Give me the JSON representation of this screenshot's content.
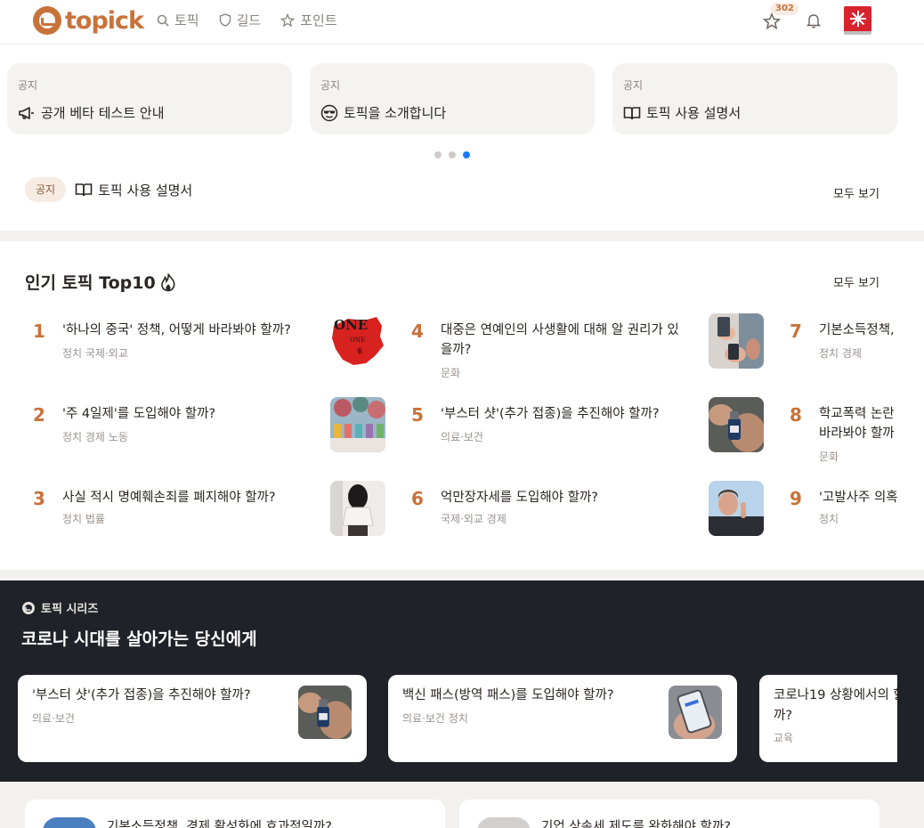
{
  "header": {
    "logo_text": "topick",
    "nav": [
      {
        "label": "토픽",
        "icon": "search-icon"
      },
      {
        "label": "길드",
        "icon": "shield-icon"
      },
      {
        "label": "포인트",
        "icon": "star-icon"
      }
    ],
    "points_badge": "302"
  },
  "notices": [
    {
      "label": "공지",
      "title": "공개 베타 테스트 안내",
      "icon": "megaphone-icon"
    },
    {
      "label": "공지",
      "title": "토픽을 소개합니다",
      "icon": "sunglasses-face-icon"
    },
    {
      "label": "공지",
      "title": "토픽 사용 설명서",
      "icon": "book-icon"
    }
  ],
  "carousel": {
    "count": 3,
    "active_index": 2
  },
  "notice_row": {
    "pill": "공지",
    "title": "토픽 사용 설명서",
    "see_all": "모두 보기"
  },
  "top10": {
    "title": "인기 토픽 Top10",
    "see_all": "모두 보기",
    "items": [
      {
        "rank": "1",
        "title": "'하나의 중국' 정책, 어떻게 바라봐야 할까?",
        "tags": "정치 국제·외교"
      },
      {
        "rank": "2",
        "title": "'주 4일제'를 도입해야 할까?",
        "tags": "정치 경제 노동"
      },
      {
        "rank": "3",
        "title": "사실 적시 명예훼손죄를 폐지해야 할까?",
        "tags": "정치 법률"
      },
      {
        "rank": "4",
        "title": "대중은 연예인의 사생활에 대해 알 권리가 있을까?",
        "tags": "문화"
      },
      {
        "rank": "5",
        "title": "'부스터 샷'(추가 접종)을 추진해야 할까?",
        "tags": "의료·보건"
      },
      {
        "rank": "6",
        "title": "억만장자세를 도입해야 할까?",
        "tags": "국제·외교 경제"
      },
      {
        "rank": "7",
        "title": "기본소득정책,",
        "tags": "정치 경제"
      },
      {
        "rank": "8",
        "title": "학교폭력 논란 바라봐야 할까",
        "tags": "문화"
      },
      {
        "rank": "9",
        "title": "'고발사주 의혹",
        "tags": "정치"
      }
    ]
  },
  "series": {
    "label": "토픽 시리즈",
    "title": "코로나 시대를 살아가는 당신에게",
    "cards": [
      {
        "title": "'부스터 샷'(추가 접종)을 추진해야 할까?",
        "tags": "의료·보건"
      },
      {
        "title": "백신 패스(방역 패스)를 도입해야 할까?",
        "tags": "의료·보건 정치"
      },
      {
        "title": "코로나19 상황에서의 할까?",
        "tags": "교육"
      }
    ]
  },
  "bottom": [
    {
      "title": "기본소득정책, 경제 활성화에 효과적일까?"
    },
    {
      "title": "기업 상속세 제도를 완화해야 할까?"
    }
  ]
}
